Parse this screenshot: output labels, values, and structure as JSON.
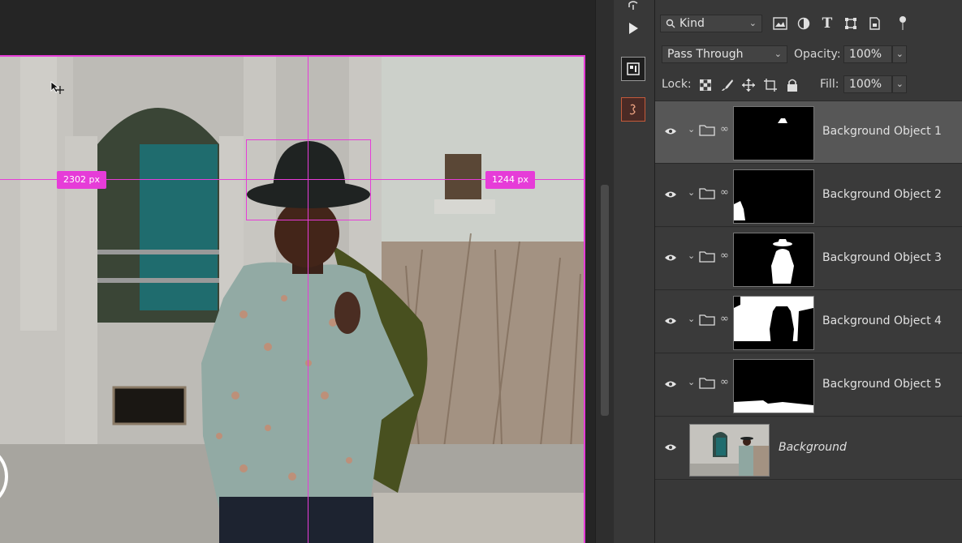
{
  "canvas": {
    "measure_left": "2302 px",
    "measure_right": "1244 px"
  },
  "mini_toolbar": {
    "icons": [
      "history-icon",
      "play-icon",
      "properties-icon",
      "libraries-icon"
    ]
  },
  "layers_panel": {
    "filter_kind_label": "Kind",
    "blend_mode": "Pass Through",
    "opacity_label": "Opacity:",
    "opacity_value": "100%",
    "lock_label": "Lock:",
    "fill_label": "Fill:",
    "fill_value": "100%",
    "layers": [
      {
        "name": "Background Object 1",
        "selected": true
      },
      {
        "name": "Background Object 2",
        "selected": false
      },
      {
        "name": "Background Object 3",
        "selected": false
      },
      {
        "name": "Background Object 4",
        "selected": false
      },
      {
        "name": "Background Object 5",
        "selected": false
      },
      {
        "name": "Background",
        "selected": false
      }
    ]
  },
  "colors": {
    "guide_color": "#e63cd8",
    "panel_bg": "#383838",
    "selected_row": "#575757"
  }
}
